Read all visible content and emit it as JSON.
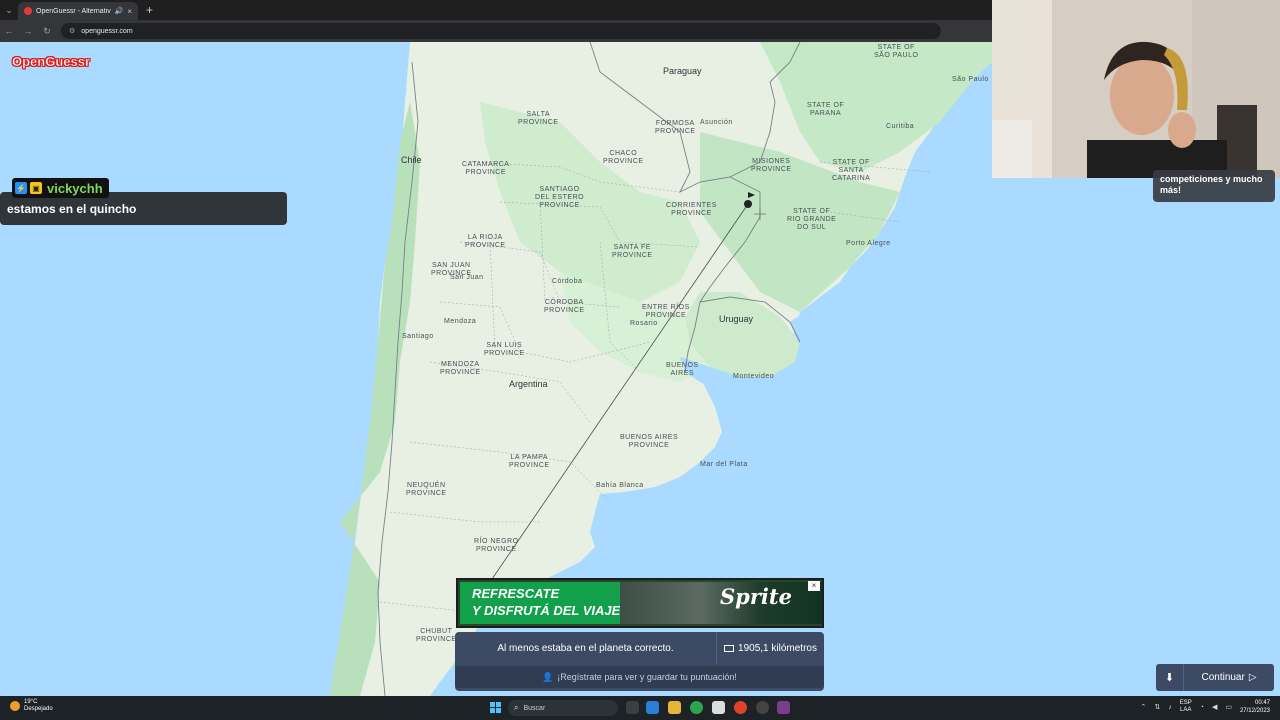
{
  "browser": {
    "tab_title": "OpenGuessr - Alternativa g",
    "tab_close": "×",
    "tab_audio": "🔊",
    "new_tab": "+",
    "url": "openguessr.com",
    "back": "←",
    "forward": "→",
    "reload": "↻",
    "tab_menu": "⌄",
    "site_info": "⚙"
  },
  "app": {
    "logo": "OpenGuessr"
  },
  "map": {
    "countries": [
      "Paraguay",
      "Chile",
      "Argentina",
      "Uruguay"
    ],
    "provinces": [
      "SALTA\nPROVINCE",
      "FORMOSA\nPROVINCE",
      "CHACO\nPROVINCE",
      "MISIONES\nPROVINCE",
      "CATAMARCA\nPROVINCE",
      "SANTIAGO\nDEL ESTERO\nPROVINCE",
      "CORRIENTES\nPROVINCE",
      "LA RIOJA\nPROVINCE",
      "SAN JUAN\nPROVINCE",
      "SANTA FE\nPROVINCE",
      "CÓRDOBA\nPROVINCE",
      "ENTRE RÍOS\nPROVINCE",
      "SAN LUIS\nPROVINCE",
      "MENDOZA\nPROVINCE",
      "BUENOS\nAIRES",
      "BUENOS AIRES\nPROVINCE",
      "LA PAMPA\nPROVINCE",
      "NEUQUÉN\nPROVINCE",
      "RÍO NEGRO\nPROVINCE",
      "CHUBUT\nPROVINCE",
      "STATE OF\nPARANA",
      "STATE OF\nSANTA\nCATARINA",
      "STATE OF\nRIO GRANDE\nDO SUL",
      "STATE OF\nSÃO PAULO"
    ],
    "cities": [
      "Asunción",
      "Córdoba",
      "Rosario",
      "Santiago",
      "Montevideo",
      "Porto Alegre",
      "Curitiba",
      "São Paulo",
      "Mar del Plata",
      "Bahía Blanca",
      "Mendoza",
      "San Juan"
    ]
  },
  "chat": {
    "username": "vickychh",
    "message": "estamos en el quincho",
    "badge1": "⚡",
    "badge2": "▣"
  },
  "promo": {
    "text": "competiciones y mucho más!"
  },
  "ad": {
    "line1": "REFRESCATE",
    "line2": "Y DISFRUTÁ DEL VIAJE",
    "brand": "Sprite",
    "close": "×"
  },
  "result": {
    "message": "Al menos estaba en el planeta correcto.",
    "distance": "1905,1 kilómetros",
    "signup": "¡Regístrate para ver y guardar tu puntuación!",
    "user_icon": "👤"
  },
  "actions": {
    "download_icon": "⬇",
    "continue_label": "Continuar",
    "continue_icon": "▷"
  },
  "taskbar": {
    "weather_temp": "19°C",
    "weather_desc": "Despejado",
    "search_placeholder": "Buscar",
    "lang_top": "ESP",
    "lang_bottom": "LAA",
    "time": "00:47",
    "date": "27/12/2023"
  },
  "colors": {
    "water": "#aadaff",
    "land": "#e8f0e4",
    "forest": "#b9e4bf",
    "accent": "#e02424"
  }
}
